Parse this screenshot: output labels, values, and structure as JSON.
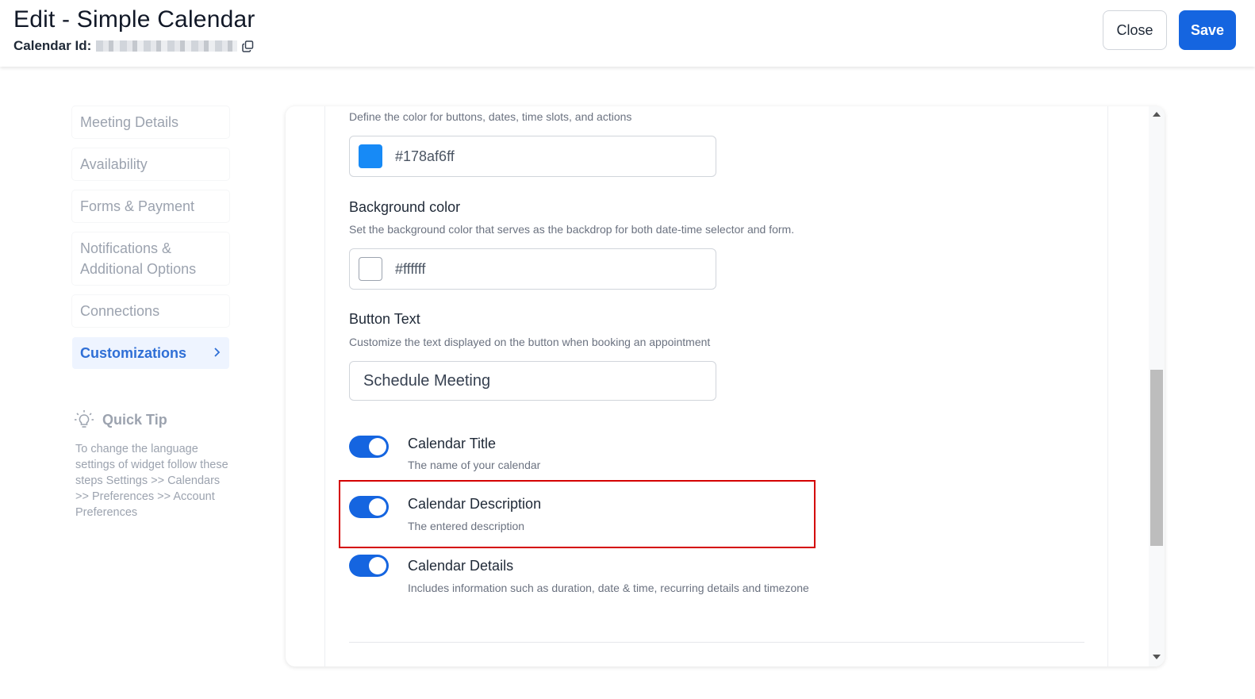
{
  "header": {
    "title": "Edit - Simple Calendar",
    "calendar_id_label": "Calendar Id:",
    "close_label": "Close",
    "save_label": "Save"
  },
  "sidebar": {
    "items": [
      {
        "label": "Meeting Details"
      },
      {
        "label": "Availability"
      },
      {
        "label": "Forms & Payment"
      },
      {
        "label": "Notifications & Additional Options"
      },
      {
        "label": "Connections"
      },
      {
        "label": "Customizations",
        "active": true
      }
    ],
    "quick_tip": {
      "title": "Quick Tip",
      "text": "To change the language settings of widget follow these steps Settings >> Calendars >> Preferences >> Account Preferences"
    }
  },
  "main": {
    "primary_color": {
      "description": "Define the color for buttons, dates, time slots, and actions",
      "value": "#178af6ff",
      "swatch": "#178af6"
    },
    "background_color": {
      "label": "Background color",
      "description": "Set the background color that serves as the backdrop for both date-time selector and form.",
      "value": "#ffffff",
      "swatch": "#ffffff"
    },
    "button_text": {
      "label": "Button Text",
      "description": "Customize the text displayed on the button when booking an appointment",
      "value": "Schedule Meeting"
    },
    "toggles": [
      {
        "title": "Calendar Title",
        "description": "The name of your calendar",
        "enabled": true
      },
      {
        "title": "Calendar Description",
        "description": "The entered description",
        "enabled": true
      },
      {
        "title": "Calendar Details",
        "description": "Includes information such as duration, date & time, recurring details and timezone",
        "enabled": true
      }
    ]
  },
  "colors": {
    "accent": "#1565e0",
    "highlight": "#d40000"
  }
}
